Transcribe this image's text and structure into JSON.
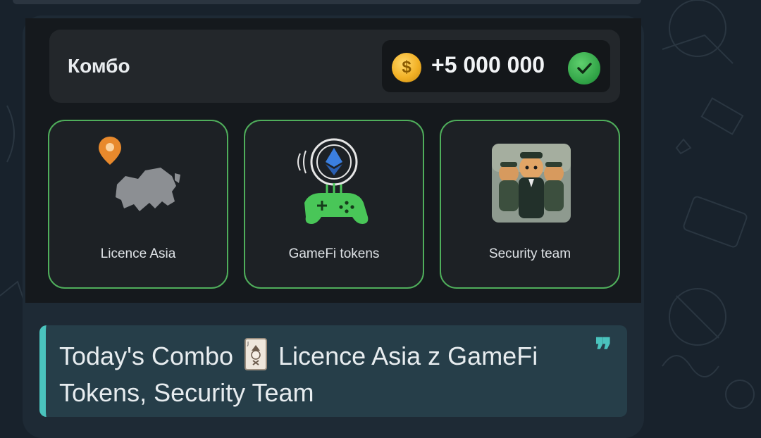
{
  "combo": {
    "title": "Комбо",
    "reward": "+5 000 000",
    "coin_symbol": "$",
    "status": "completed"
  },
  "cards": [
    {
      "label": "Licence Asia",
      "icon": "asia-map-pin-icon"
    },
    {
      "label": "GameFi tokens",
      "icon": "ethereum-gamepad-icon"
    },
    {
      "label": "Security team",
      "icon": "hamster-security-team-image"
    }
  ],
  "message": {
    "part1": "Today's Combo",
    "emoji": "joker-card",
    "part2": "Licence Asia z GameFi Tokens, Security Team",
    "quote_mark": "❞"
  },
  "colors": {
    "accent_green": "#4fae5b",
    "quote_accent": "#4ac3bd",
    "coin": "#f2b126"
  }
}
